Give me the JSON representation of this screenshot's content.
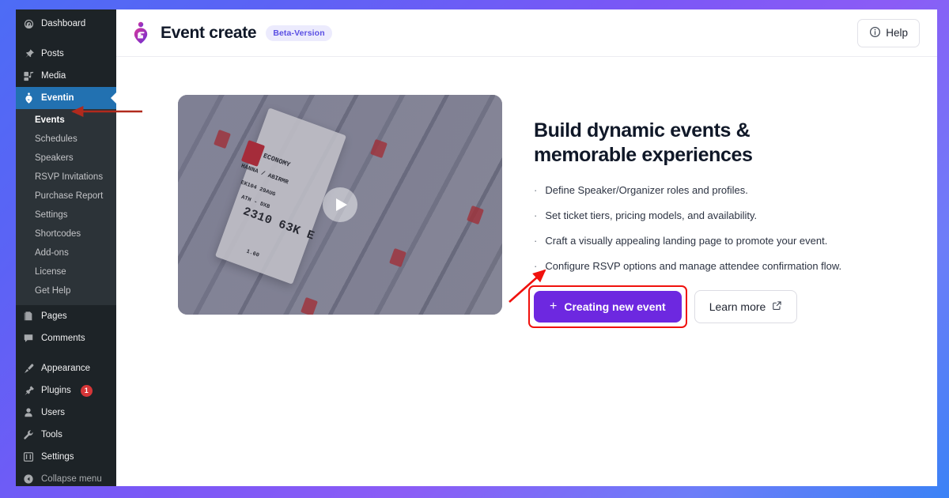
{
  "theme": {
    "page_gradient_start": "#4d6cf5",
    "page_gradient_mid": "#8b5cf6",
    "page_gradient_end": "#3b82f6",
    "sidebar_bg": "#1d2327",
    "sidebar_submenu_bg": "#2c3338",
    "sidebar_active_bg": "#2271b1",
    "primary_button_bg": "#6d28e0",
    "annotation_red": "#f0110d",
    "badge_red": "#d63638",
    "beta_badge_bg": "#ecebfd",
    "beta_badge_text": "#5b50e3"
  },
  "sidebar": {
    "items": [
      {
        "label": "Dashboard",
        "icon": "dashboard-icon",
        "active": false
      },
      {
        "label": "Posts",
        "icon": "pin-icon",
        "active": false
      },
      {
        "label": "Media",
        "icon": "media-icon",
        "active": false
      },
      {
        "label": "Eventin",
        "icon": "eventin-icon",
        "active": true
      }
    ],
    "submenu": [
      {
        "label": "Events",
        "current": true
      },
      {
        "label": "Schedules",
        "current": false
      },
      {
        "label": "Speakers",
        "current": false
      },
      {
        "label": "RSVP Invitations",
        "current": false
      },
      {
        "label": "Purchase Report",
        "current": false
      },
      {
        "label": "Settings",
        "current": false
      },
      {
        "label": "Shortcodes",
        "current": false
      },
      {
        "label": "Add-ons",
        "current": false
      },
      {
        "label": "License",
        "current": false
      },
      {
        "label": "Get Help",
        "current": false
      }
    ],
    "group_two": [
      {
        "label": "Pages",
        "icon": "pages-icon"
      },
      {
        "label": "Comments",
        "icon": "comment-icon"
      }
    ],
    "group_three": [
      {
        "label": "Appearance",
        "icon": "brush-icon",
        "badge": ""
      },
      {
        "label": "Plugins",
        "icon": "plugin-icon",
        "badge": "1"
      },
      {
        "label": "Users",
        "icon": "user-icon",
        "badge": ""
      },
      {
        "label": "Tools",
        "icon": "wrench-icon",
        "badge": ""
      },
      {
        "label": "Settings",
        "icon": "sliders-icon",
        "badge": ""
      }
    ],
    "collapse": {
      "label": "Collapse menu",
      "icon": "collapse-icon"
    }
  },
  "topbar": {
    "logo_icon": "eventin-logo-icon",
    "title": "Event create",
    "beta_badge": "Beta-Version",
    "help_label": "Help",
    "help_icon": "info-circle-icon"
  },
  "video": {
    "play_icon": "play-icon",
    "ticket_texts": {
      "class": "ECONOMY",
      "passenger": "HANNA / ABIRMR",
      "flight": "EK104   29AUG",
      "route": "ATH  -  DXB",
      "seat": "2310 63K  E",
      "small": "1.60"
    }
  },
  "main": {
    "headline": "Build dynamic events &\nmemorable experiences",
    "features": [
      "Define Speaker/Organizer roles and profiles.",
      "Set ticket tiers, pricing models, and availability.",
      "Craft a visually appealing landing page to promote your event.",
      "Configure RSVP options and manage attendee confirmation flow."
    ],
    "create_button": {
      "label": "Creating new event",
      "icon": "plus-icon"
    },
    "learn_button": {
      "label": "Learn more",
      "icon": "external-link-icon"
    }
  },
  "annotations": [
    {
      "name": "arrow-to-events",
      "target": "Events"
    },
    {
      "name": "arrow-to-create-button",
      "target": "Creating new event"
    }
  ]
}
